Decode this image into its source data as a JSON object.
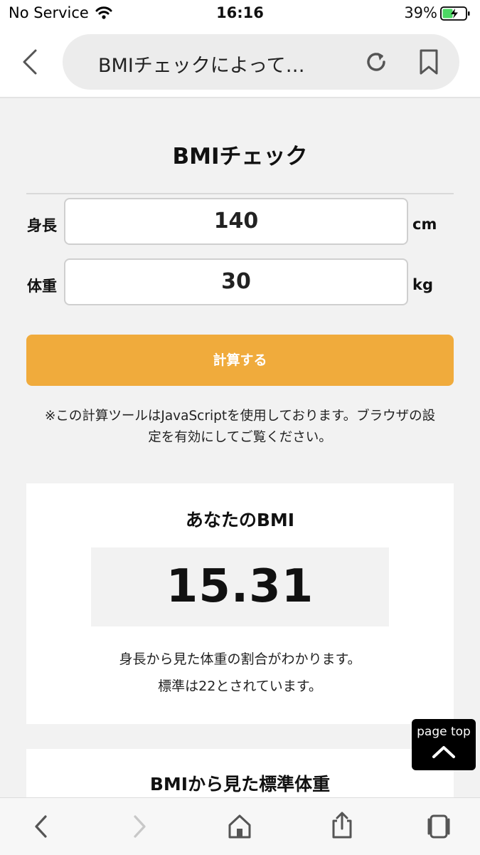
{
  "status_bar": {
    "carrier": "No Service",
    "time": "16:16",
    "battery_percent": "39%",
    "icons": [
      "wifi-icon",
      "battery-charging-icon"
    ]
  },
  "browser": {
    "url_text": "BMIチェックによって…",
    "icons": [
      "back-chevron-icon",
      "reload-icon",
      "bookmark-icon"
    ]
  },
  "form": {
    "title": "BMIチェック",
    "height_label": "身長",
    "height_value": "140",
    "height_unit": "cm",
    "weight_label": "体重",
    "weight_value": "30",
    "weight_unit": "kg",
    "calculate_label": "計算する",
    "notice_line1": "※この計算ツールはJavaScriptを使用しております。ブラウザの設",
    "notice_line2": "定を有効にしてご覧ください。"
  },
  "result": {
    "title": "あなたのBMI",
    "bmi_value": "15.31",
    "desc_line1": "身長から見た体重の割合がわかります。",
    "desc_line2": "標準は22とされています。"
  },
  "standard": {
    "title": "BMIから見た標準体重"
  },
  "page_top": {
    "label": "page top"
  },
  "toolbar": {
    "icons": [
      "back-icon",
      "forward-icon",
      "home-icon",
      "share-icon",
      "tabs-icon"
    ]
  },
  "colors": {
    "accent_button": "#f0ab3c",
    "background": "#f2f2f2",
    "card": "#ffffff",
    "battery_green": "#4cd964"
  }
}
